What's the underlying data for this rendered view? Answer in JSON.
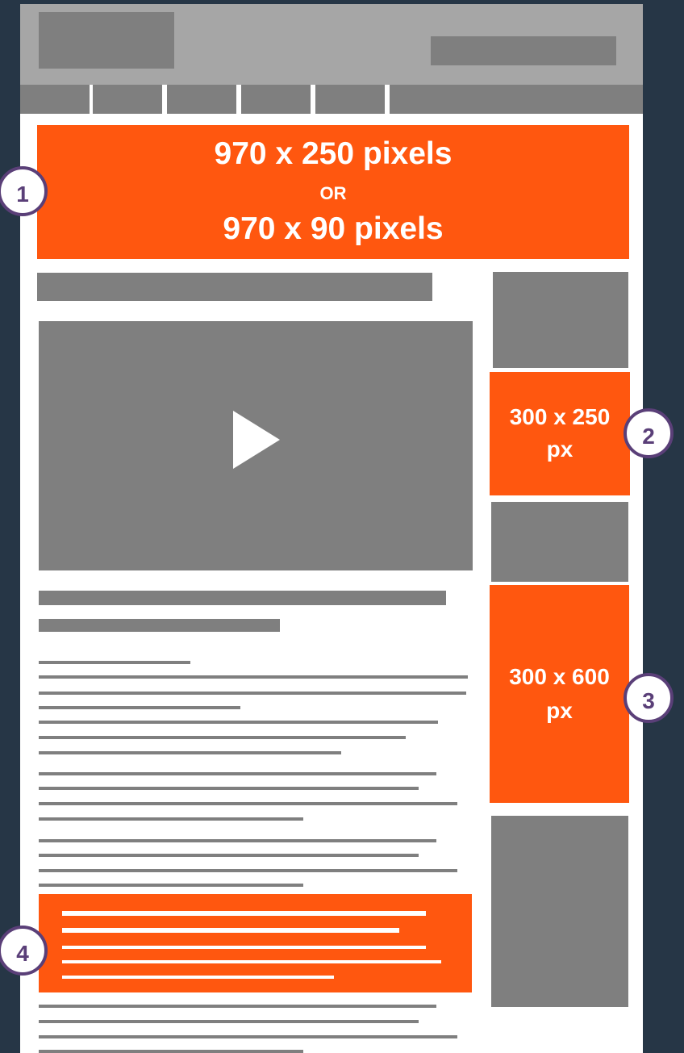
{
  "banner": {
    "line1": "970 x 250 pixels",
    "line2": "OR",
    "line3": "970 x 90 pixels",
    "marker": "1"
  },
  "ad_medium_rectangle": {
    "line1": "300 x 250",
    "line2": "px",
    "marker": "2"
  },
  "ad_half_page": {
    "line1": "300 x 600",
    "line2": "px",
    "marker": "3"
  },
  "ad_in_article": {
    "marker": "4"
  },
  "colors": {
    "background": "#263646",
    "page": "#ffffff",
    "ad_slot": "#ff570f",
    "placeholder": "#7f7f7f",
    "header": "#a6a6a6",
    "marker_border": "#5a3f78"
  }
}
